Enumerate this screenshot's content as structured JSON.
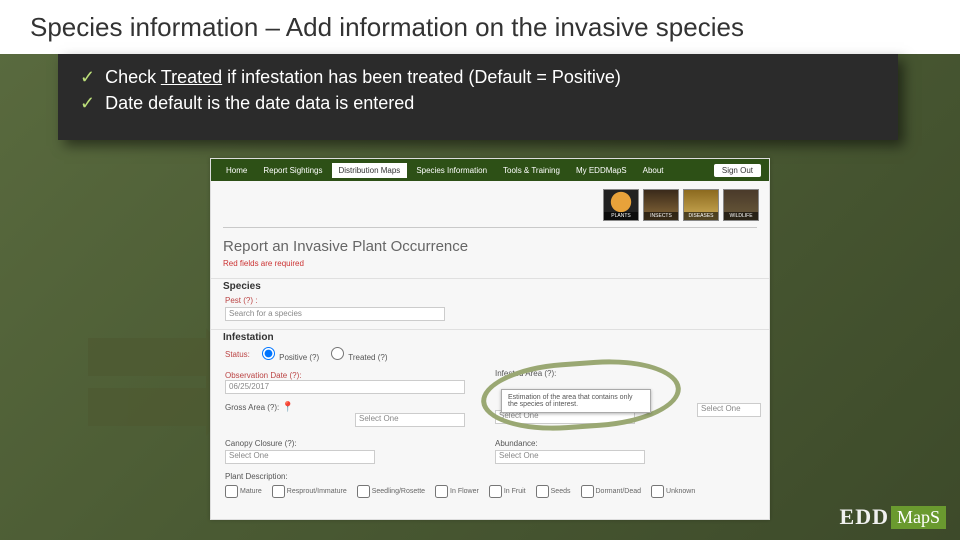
{
  "title": "Species information – Add information on the invasive species",
  "bullets": {
    "b1_pre": "Check ",
    "b1_u": "Treated",
    "b1_post": " if infestation has been treated (Default = Positive)",
    "b2": "Date default is the date data is entered"
  },
  "nav": {
    "home": "Home",
    "report": "Report Sightings",
    "maps": "Distribution Maps",
    "species": "Species Information",
    "tools": "Tools & Training",
    "my": "My EDDMapS",
    "about": "About",
    "signout": "Sign Out"
  },
  "thumbs": {
    "plants": "PLANTS",
    "insects": "INSECTS",
    "diseases": "DISEASES",
    "wildlife": "WILDLIFE"
  },
  "form": {
    "title": "Report an Invasive Plant Occurrence",
    "required": "Red fields are required",
    "species_h": "Species",
    "pest": "Pest (?) :",
    "pest_ph": "Search for a species",
    "infest_h": "Infestation",
    "status_l": "Status:",
    "status_pos": "Positive (?)",
    "status_trt": "Treated (?)",
    "obs_l": "Observation Date (?):",
    "obs_val": "06/25/2017",
    "gross_l": "Gross Area (?):",
    "selectone": "Select One",
    "infested_l": "Infested Area (?):",
    "tooltip": "Estimation of the area that contains only the species of interest.",
    "canopy_l": "Canopy Closure (?):",
    "abund_l": "Abundance:",
    "plantdesc_l": "Plant Description:",
    "d1": "Mature",
    "d2": "Resprout/Immature",
    "d3": "Seedling/Rosette",
    "d4": "In Flower",
    "d5": "In Fruit",
    "d6": "Seeds",
    "d7": "Dormant/Dead",
    "d8": "Unknown"
  },
  "logo": {
    "edd": "EDD",
    "maps": "MapS"
  }
}
